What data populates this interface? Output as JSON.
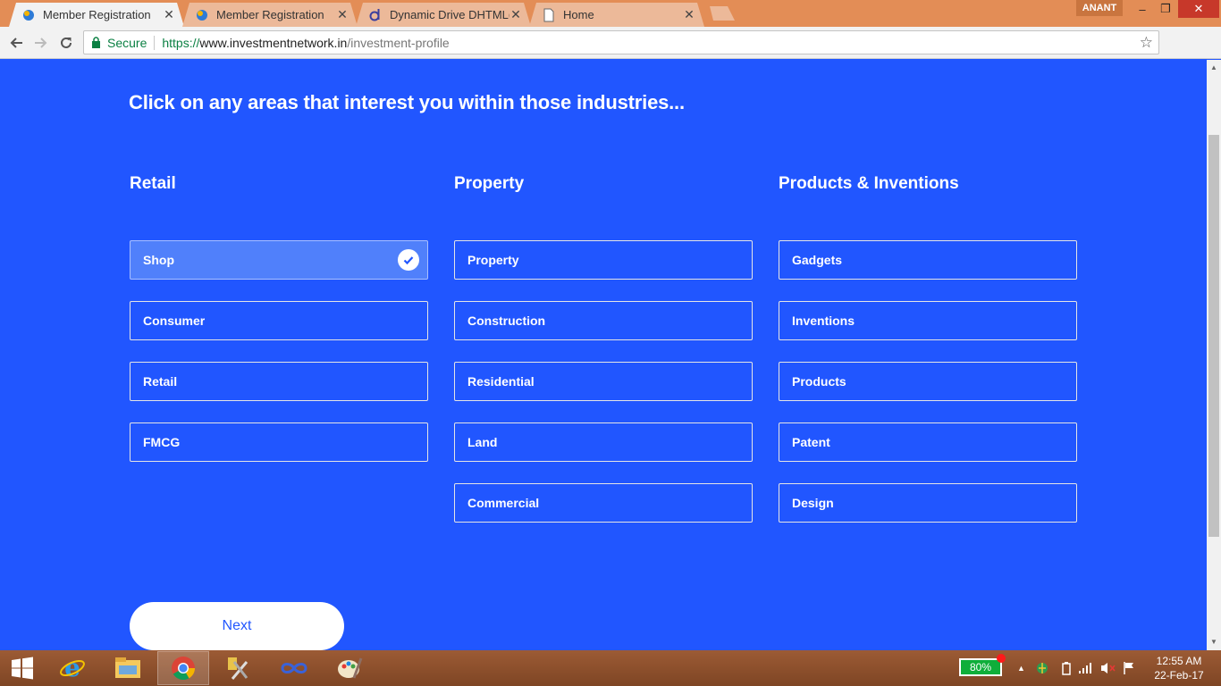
{
  "browser": {
    "tabs": [
      {
        "title": "Member Registration",
        "icon": "blue-globe-icon",
        "active": true
      },
      {
        "title": "Member Registration",
        "icon": "blue-globe-icon",
        "active": false
      },
      {
        "title": "Dynamic Drive DHTML(d",
        "icon": "dynamic-drive-icon",
        "active": false
      },
      {
        "title": "Home",
        "icon": "document-icon",
        "active": false
      }
    ],
    "user": "ANANT",
    "secure_label": "Secure",
    "url_scheme": "https://",
    "url_host": "www.investmentnetwork.in",
    "url_path": "/investment-profile"
  },
  "page": {
    "heading": "Click on any areas that interest you within those industries...",
    "columns": [
      {
        "title": "Retail",
        "options": [
          {
            "label": "Shop",
            "selected": true
          },
          {
            "label": "Consumer",
            "selected": false
          },
          {
            "label": "Retail",
            "selected": false
          },
          {
            "label": "FMCG",
            "selected": false
          }
        ]
      },
      {
        "title": "Property",
        "options": [
          {
            "label": "Property",
            "selected": false
          },
          {
            "label": "Construction",
            "selected": false
          },
          {
            "label": "Residential",
            "selected": false
          },
          {
            "label": "Land",
            "selected": false
          },
          {
            "label": "Commercial",
            "selected": false
          }
        ]
      },
      {
        "title": "Products & Inventions",
        "options": [
          {
            "label": "Gadgets",
            "selected": false
          },
          {
            "label": "Inventions",
            "selected": false
          },
          {
            "label": "Products",
            "selected": false
          },
          {
            "label": "Patent",
            "selected": false
          },
          {
            "label": "Design",
            "selected": false
          }
        ]
      }
    ],
    "next_label": "Next"
  },
  "taskbar": {
    "apps": [
      "windows-start-icon",
      "internet-explorer-icon",
      "file-explorer-icon",
      "chrome-icon",
      "tools-icon",
      "infinity-app-icon",
      "paint-icon"
    ],
    "battery": "80%",
    "time": "12:55 AM",
    "date": "22-Feb-17"
  },
  "colors": {
    "page_bg": "#2156ff",
    "selected_option_bg": "#5080fb",
    "taskbar": "#8a4c2a",
    "tabstrip": "#e38d56"
  }
}
